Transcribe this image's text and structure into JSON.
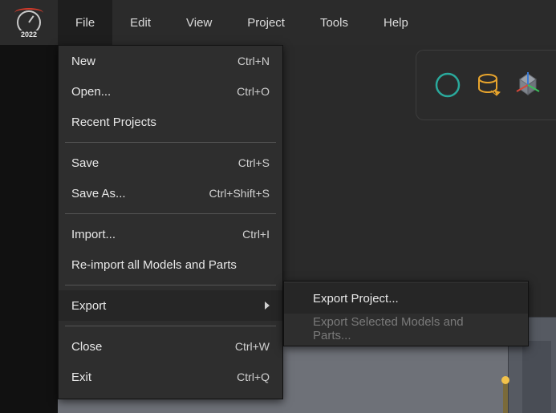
{
  "app": {
    "logo_year": "2022"
  },
  "menubar": {
    "items": [
      "File",
      "Edit",
      "View",
      "Project",
      "Tools",
      "Help"
    ],
    "active_index": 0
  },
  "file_menu": {
    "groups": [
      [
        {
          "label": "New",
          "shortcut": "Ctrl+N"
        },
        {
          "label": "Open...",
          "shortcut": "Ctrl+O"
        },
        {
          "label": "Recent Projects",
          "shortcut": ""
        }
      ],
      [
        {
          "label": "Save",
          "shortcut": "Ctrl+S"
        },
        {
          "label": "Save As...",
          "shortcut": "Ctrl+Shift+S"
        }
      ],
      [
        {
          "label": "Import...",
          "shortcut": "Ctrl+I"
        },
        {
          "label": "Re-import all Models and Parts",
          "shortcut": ""
        }
      ],
      [
        {
          "label": "Export",
          "shortcut": "",
          "submenu": true,
          "highlight": true
        }
      ],
      [
        {
          "label": "Close",
          "shortcut": "Ctrl+W"
        },
        {
          "label": "Exit",
          "shortcut": "Ctrl+Q"
        }
      ]
    ]
  },
  "export_submenu": {
    "items": [
      {
        "label": "Export Project...",
        "enabled": true,
        "highlight": true
      },
      {
        "label": "Export Selected Models and Parts...",
        "enabled": false
      }
    ]
  },
  "toolbar": {
    "buttons": [
      "circle-tool-icon",
      "database-tool-icon",
      "axis-gizmo-icon"
    ]
  }
}
